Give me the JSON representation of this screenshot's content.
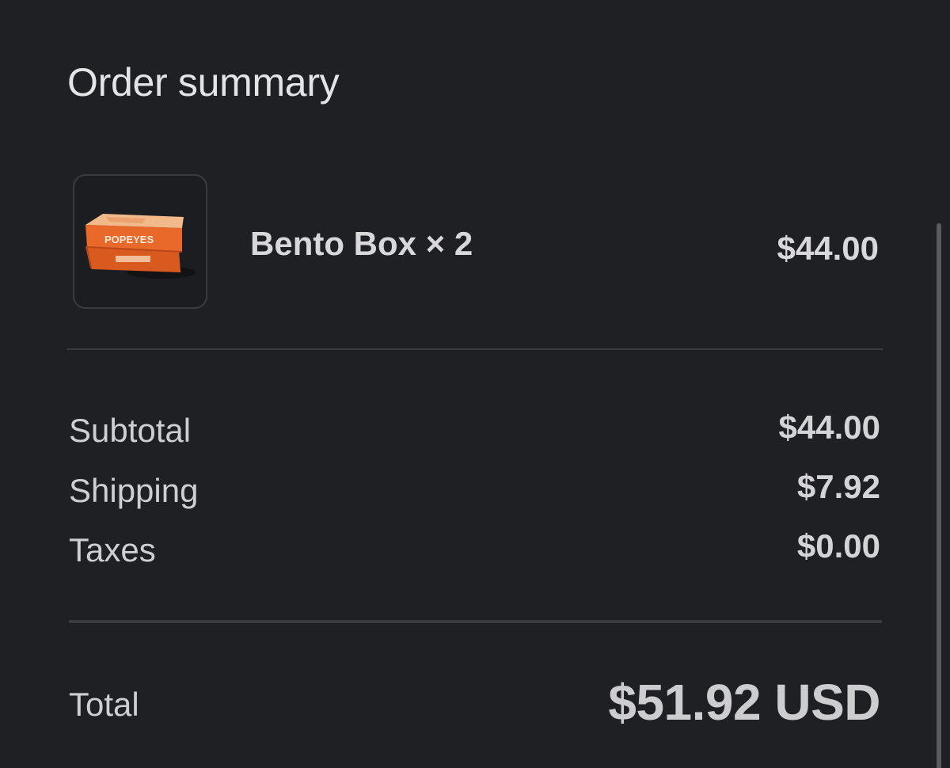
{
  "header": {
    "title": "Order summary"
  },
  "line_item": {
    "name": "Bento Box × 2",
    "price": "$44.00",
    "thumbnail": {
      "brand_text": "POPEYES",
      "accent_color": "#e8692a"
    }
  },
  "summary": {
    "rows": [
      {
        "label": "Subtotal",
        "value": "$44.00"
      },
      {
        "label": "Shipping",
        "value": "$7.92"
      },
      {
        "label": "Taxes",
        "value": "$0.00"
      }
    ],
    "total_label": "Total",
    "total_value": "$51.92 USD"
  },
  "colors": {
    "background": "#1f2024",
    "divider": "#3a3b40",
    "text_primary": "#d8d8da"
  }
}
